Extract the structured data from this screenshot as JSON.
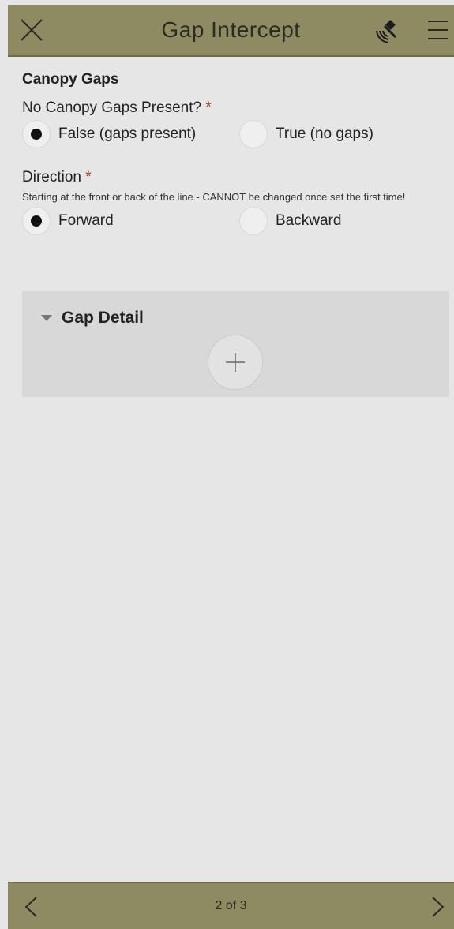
{
  "header": {
    "title": "Gap Intercept",
    "close_icon": "close-icon",
    "gps_icon": "gps-satellite-icon",
    "menu_icon": "hamburger-menu-icon"
  },
  "form": {
    "section_title": "Canopy Gaps",
    "no_gaps_field": {
      "label": "No Canopy Gaps Present?",
      "required_mark": "*",
      "options": [
        {
          "label": "False (gaps present)",
          "selected": true
        },
        {
          "label": "True (no gaps)",
          "selected": false
        }
      ]
    },
    "direction_field": {
      "label": "Direction",
      "required_mark": "*",
      "hint": "Starting at the front or back of the line - CANNOT be changed once set the first time!",
      "options": [
        {
          "label": "Forward",
          "selected": true
        },
        {
          "label": "Backward",
          "selected": false
        }
      ]
    },
    "repeat_group": {
      "label": "Gap Detail",
      "add_icon": "plus-icon"
    }
  },
  "footer": {
    "pager_text": "2 of 3",
    "prev_icon": "chevron-left-icon",
    "next_icon": "chevron-right-icon"
  },
  "colors": {
    "bar": "#8e8a62",
    "background": "#e6e6e6",
    "required": "#c0392b"
  }
}
